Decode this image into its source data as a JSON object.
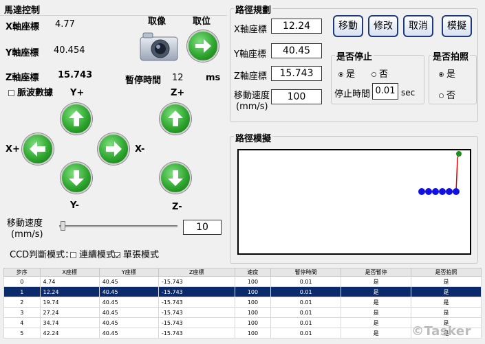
{
  "motor": {
    "title": "馬達控制",
    "x_label": "X軸座標",
    "x_value": "4.77",
    "y_label": "Y軸座標",
    "y_value": "40.454",
    "z_label": "Z軸座標",
    "z_value": "15.743",
    "capture_label": "取像",
    "fetch_label": "取位",
    "pause_label": "暫停時間",
    "pause_value": "12",
    "pause_unit": "ms",
    "pulse_label": "脈波數據",
    "y_plus": "Y+",
    "y_minus": "Y-",
    "x_plus": "X+",
    "x_minus": "X-",
    "z_plus": "Z+",
    "z_minus": "Z-",
    "speed_label": "移動速度",
    "speed_unit": "(mm/s)",
    "speed_value": "10",
    "ccd_label": "CCD判斷模式：",
    "continuous_mode": "連續模式",
    "single_mode": "單張模式"
  },
  "path": {
    "title": "路徑規劃",
    "x_label": "X軸座標",
    "x_value": "12.24",
    "y_label": "Y軸座標",
    "y_value": "40.45",
    "z_label": "Z軸座標",
    "z_value": "15.743",
    "speed_label": "移動速度",
    "speed_unit": "(mm/s)",
    "speed_value": "100",
    "buttons": {
      "move": "移動",
      "edit": "修改",
      "cancel": "取消",
      "simulate": "模擬"
    },
    "stop_group": "是否停止",
    "yes": "是",
    "no": "否",
    "stop_time_label": "停止時間",
    "stop_time_value": "0.01",
    "stop_time_unit": "sec",
    "photo_group": "是否拍照",
    "sim_title": "路徑模擬"
  },
  "table": {
    "headers": [
      "步序",
      "X座標",
      "Y座標",
      "Z座標",
      "速度",
      "暫停時間",
      "是否暫停",
      "是否拍照"
    ],
    "rows": [
      [
        "0",
        "4.74",
        "40.45",
        "-15.743",
        "100",
        "0.01",
        "是",
        "是"
      ],
      [
        "1",
        "12.24",
        "40.45",
        "-15.743",
        "100",
        "0.01",
        "是",
        "是"
      ],
      [
        "2",
        "19.74",
        "40.45",
        "-15.743",
        "100",
        "0.01",
        "是",
        "是"
      ],
      [
        "3",
        "27.24",
        "40.45",
        "-15.743",
        "100",
        "0.01",
        "是",
        "是"
      ],
      [
        "4",
        "34.74",
        "40.45",
        "-15.743",
        "100",
        "0.01",
        "是",
        "是"
      ],
      [
        "5",
        "42.24",
        "40.45",
        "-15.743",
        "100",
        "0.01",
        "是",
        "是"
      ]
    ],
    "selected_row": 1
  },
  "watermark": "©Tasker",
  "colors": {
    "selection": "#0a2a6b",
    "arrow_green": "#2fa62f",
    "path_point": "#1010e0",
    "path_line": "#e00000"
  }
}
